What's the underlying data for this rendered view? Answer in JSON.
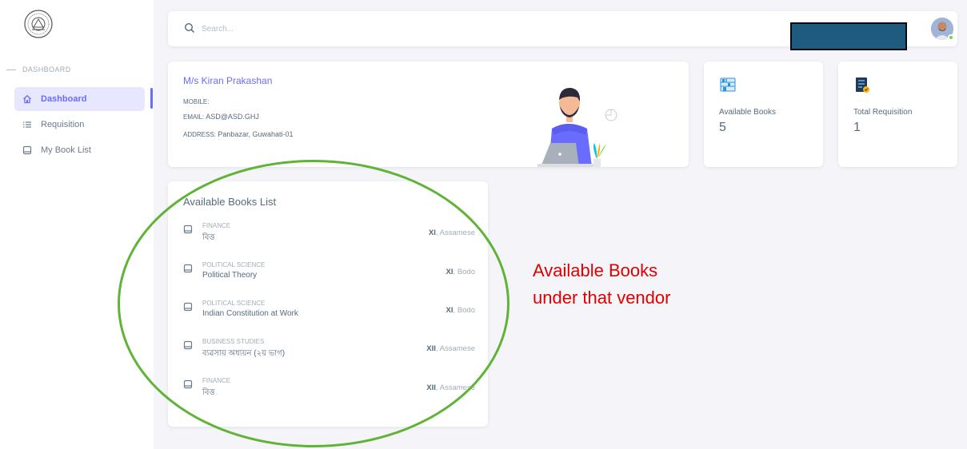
{
  "sidebar": {
    "section_header": "DASHBOARD",
    "items": [
      {
        "label": "Dashboard",
        "icon": "home-icon",
        "active": true
      },
      {
        "label": "Requisition",
        "icon": "list-icon",
        "active": false
      },
      {
        "label": "My Book List",
        "icon": "book-icon",
        "active": false
      }
    ]
  },
  "navbar": {
    "search_placeholder": "Search...",
    "avatar_icon": "user-avatar"
  },
  "vendor": {
    "name": "M/s Kiran Prakashan",
    "mobile_label": "MOBILE:",
    "mobile_value": "",
    "email_label": "EMAIL:",
    "email_value": "ASD@ASD.GHJ",
    "address_label": "ADDRESS:",
    "address_value": "Panbazar, Guwahati-01"
  },
  "stats": [
    {
      "label": "Available Books",
      "value": "5",
      "icon": "books-icon"
    },
    {
      "label": "Total Requisition",
      "value": "1",
      "icon": "requisition-icon"
    }
  ],
  "books_list": {
    "title": "Available Books List",
    "items": [
      {
        "category": "FINANCE",
        "name": "বিত্ত",
        "class": "XI",
        "language": "Assamese"
      },
      {
        "category": "POLITICAL SCIENCE",
        "name": "Political Theory",
        "class": "XI",
        "language": "Bodo"
      },
      {
        "category": "POLITICAL SCIENCE",
        "name": "Indian Constitution at Work",
        "class": "XI",
        "language": "Bodo"
      },
      {
        "category": "BUSINESS STUDIES",
        "name": "ব্যৱসায় অধ্যয়ন (২য় ভাগ)",
        "class": "XII",
        "language": "Assamese"
      },
      {
        "category": "FINANCE",
        "name": "বিত্ত",
        "class": "XII",
        "language": "Assamese"
      }
    ]
  },
  "annotation": {
    "line1": "Available Books",
    "line2": "under that vendor"
  },
  "colors": {
    "accent": "#696cff",
    "annotation_red": "#e00000",
    "ellipse_green": "#5fb336",
    "redaction": "#1e5b7e"
  }
}
